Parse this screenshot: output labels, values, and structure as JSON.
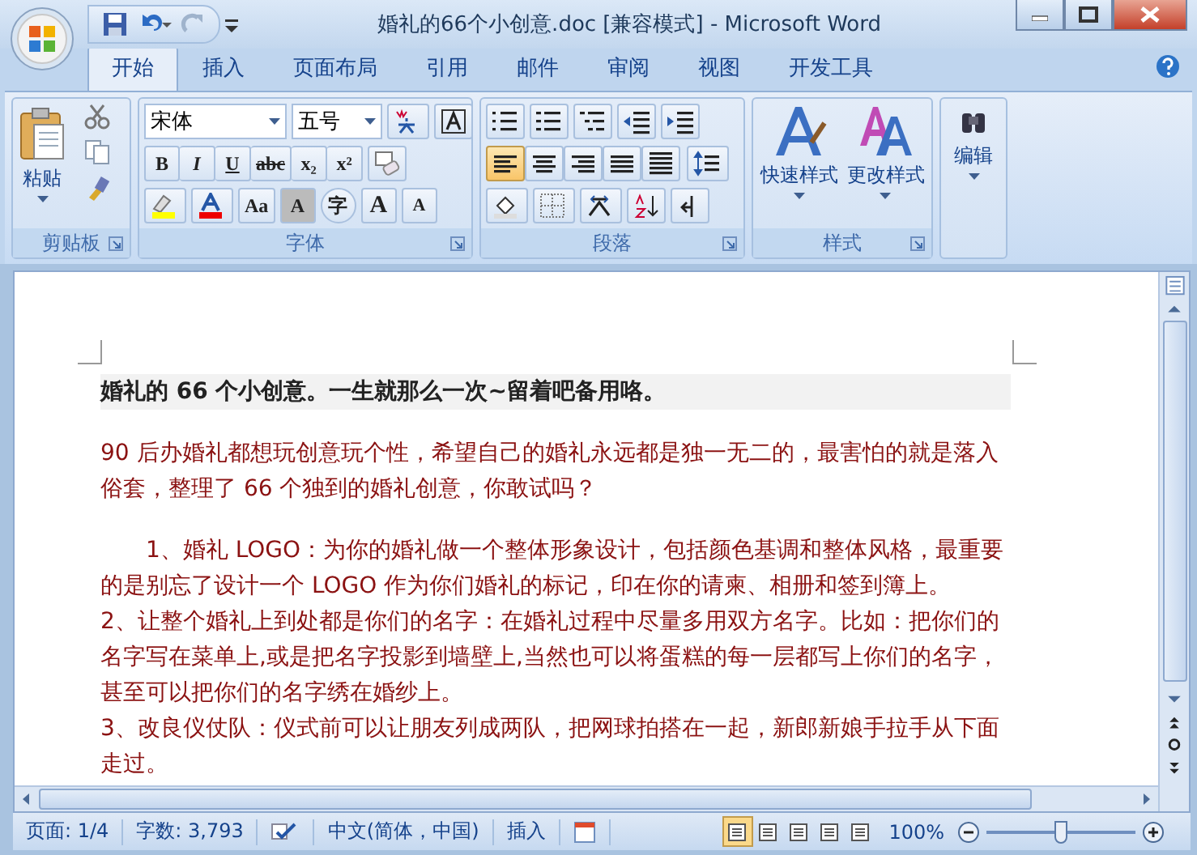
{
  "window": {
    "title": "婚礼的66个小创意.doc [兼容模式] - Microsoft Word"
  },
  "ribbon": {
    "tabs": [
      {
        "label": "开始",
        "selected": true
      },
      {
        "label": "插入",
        "selected": false
      },
      {
        "label": "页面布局",
        "selected": false
      },
      {
        "label": "引用",
        "selected": false
      },
      {
        "label": "邮件",
        "selected": false
      },
      {
        "label": "审阅",
        "selected": false
      },
      {
        "label": "视图",
        "selected": false
      },
      {
        "label": "开发工具",
        "selected": false
      }
    ],
    "clipboard": {
      "name": "剪贴板",
      "paste": "粘贴"
    },
    "font": {
      "name": "字体",
      "font_name": "宋体",
      "font_size": "五号",
      "row1": [
        "B",
        "I",
        "U",
        "abc",
        "x₂",
        "x²"
      ],
      "row2_text": [
        "Aa",
        "A",
        "字",
        "A",
        "A"
      ]
    },
    "paragraph": {
      "name": "段落",
      "alignments": [
        {
          "selected": true
        },
        {
          "selected": false
        },
        {
          "selected": false
        },
        {
          "selected": false
        },
        {
          "selected": false
        }
      ]
    },
    "styles": {
      "name": "样式",
      "quick": "快速样式",
      "change": "更改样式"
    },
    "editing": {
      "label": "编辑"
    }
  },
  "document": {
    "title": "婚礼的 66 个小创意。一生就那么一次~留着吧备用咯。",
    "paragraphs": [
      {
        "text": "90 后办婚礼都想玩创意玩个性，希望自己的婚礼永远都是独一无二的，最害怕的就是落入俗套，整理了 66 个独到的婚礼创意，你敢试吗？",
        "indent": false
      },
      {
        "text": "1、婚礼 LOGO：为你的婚礼做一个整体形象设计，包括颜色基调和整体风格，最重要的是别忘了设计一个 LOGO 作为你们婚礼的标记，印在你的请柬、相册和签到簿上。",
        "indent": true
      },
      {
        "text": "2、让整个婚礼上到处都是你们的名字：在婚礼过程中尽量多用双方名字。比如：把你们的名字写在菜单上,或是把名字投影到墙壁上,当然也可以将蛋糕的每一层都写上你们的名字，甚至可以把你们的名字绣在婚纱上。",
        "indent": false
      },
      {
        "text": "3、改良仪仗队：仪式前可以让朋友列成两队，把网球拍搭在一起，新郎新娘手拉手从下面走过。",
        "indent": false
      }
    ]
  },
  "status_bar": {
    "page": "页面: 1/4",
    "words": "字数: 3,793",
    "language": "中文(简体，中国)",
    "mode": "插入",
    "views": [
      {
        "selected": true
      },
      {
        "selected": false
      },
      {
        "selected": false
      },
      {
        "selected": false
      },
      {
        "selected": false
      }
    ],
    "zoom": "100%",
    "zoom_slider": {
      "level": 0.5
    }
  }
}
